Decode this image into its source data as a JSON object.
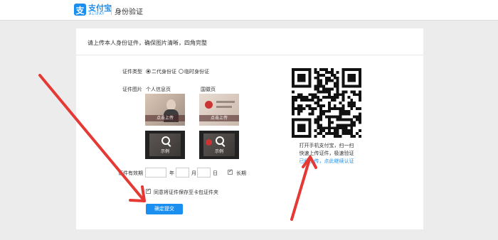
{
  "header": {
    "logo_cn": "支付宝",
    "logo_en": "ALIPAY",
    "logo_glyph": "支",
    "page_title": "身份验证",
    "brand_color": "#1a8ff0"
  },
  "card": {
    "title": "请上传本人身份证件，确保图片清晰，四角完整"
  },
  "form": {
    "id_type_label": "证件类型",
    "id_type_options": [
      "二代身份证",
      "临时身份证"
    ],
    "id_type_selected": "二代身份证",
    "id_image_label": "证件图片",
    "front_label": "个人信息页",
    "back_label": "国徽页",
    "upload_label": "点击上传",
    "sample_label": "示例",
    "validity_label": "证件有效期",
    "year_unit": "年",
    "month_unit": "月",
    "day_unit": "日",
    "long_term_label": "长期",
    "long_term_checked": true,
    "agree_label": "同意将证件保存至卡包证件夹",
    "agree_checked": true,
    "submit_label": "确定提交"
  },
  "qr_panel": {
    "line1": "打开手机支付宝，扫一扫",
    "line2": "快速上传证件，极速验证",
    "link": "已经上传，点此继续认证"
  },
  "annotations": {
    "arrow_color": "#e53935"
  }
}
